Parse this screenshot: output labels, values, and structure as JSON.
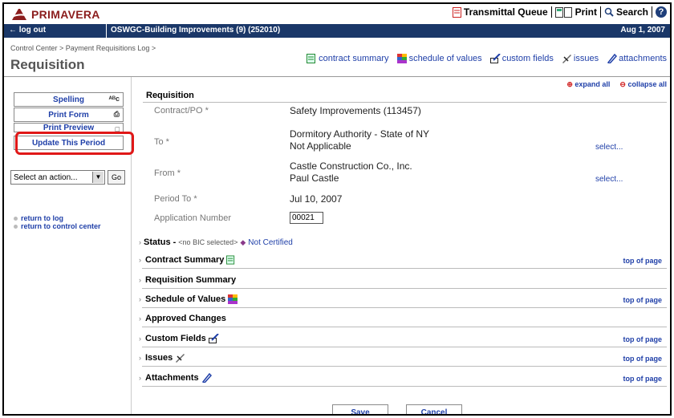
{
  "brand": {
    "name": "PRIMAVERA"
  },
  "top_links": {
    "transmittal": "Transmittal Queue",
    "print": "Print",
    "search": "Search",
    "help": "?"
  },
  "bluebar": {
    "logout": "log out",
    "project": "OSWGC-Building Improvements (9) (252010)",
    "date": "Aug 1, 2007"
  },
  "header": {
    "breadcrumb": "Control Center > Payment Requisitions Log >",
    "title": "Requisition"
  },
  "toolbar": {
    "contract_summary": "contract summary",
    "schedule_of_values": "schedule of values",
    "custom_fields": "custom fields",
    "issues": "issues",
    "attachments": "attachments"
  },
  "sidebar": {
    "spelling": "Spelling",
    "print_form": "Print Form",
    "print_preview": "Print Preview",
    "update_period": "Update This Period",
    "action_select": "Select an action...",
    "go": "Go",
    "return_log": "return to log",
    "return_control": "return to control center"
  },
  "main": {
    "expand_all": "expand all",
    "collapse_all": "collapse all",
    "section_title": "Requisition",
    "fields": {
      "contract_label": "Contract/PO *",
      "contract_value": "Safety Improvements (113457)",
      "to_label": "To *",
      "to_value1": "Dormitory Authority - State of NY",
      "to_value2": "Not Applicable",
      "from_label": "From *",
      "from_value1": "Castle Construction Co., Inc.",
      "from_value2": "Paul Castle",
      "period_label": "Period To *",
      "period_value": "Jul 10, 2007",
      "app_label": "Application Number",
      "app_value": "00021",
      "select": "select..."
    },
    "status": {
      "label": "Status",
      "nobic": "<no BIC selected>",
      "value": "Not Certified"
    },
    "sections": {
      "contract_summary": "Contract Summary",
      "requisition_summary": "Requisition Summary",
      "schedule_of_values": "Schedule of Values",
      "approved_changes": "Approved Changes",
      "custom_fields": "Custom Fields",
      "issues": "Issues",
      "attachments": "Attachments",
      "top_of_page": "top of page"
    }
  },
  "buttons": {
    "save": "Save",
    "cancel": "Cancel"
  },
  "colors": {
    "brand": "#8b1d1d",
    "bar": "#1a3768",
    "link": "#1f3fa8",
    "highlight": "#e01818"
  }
}
